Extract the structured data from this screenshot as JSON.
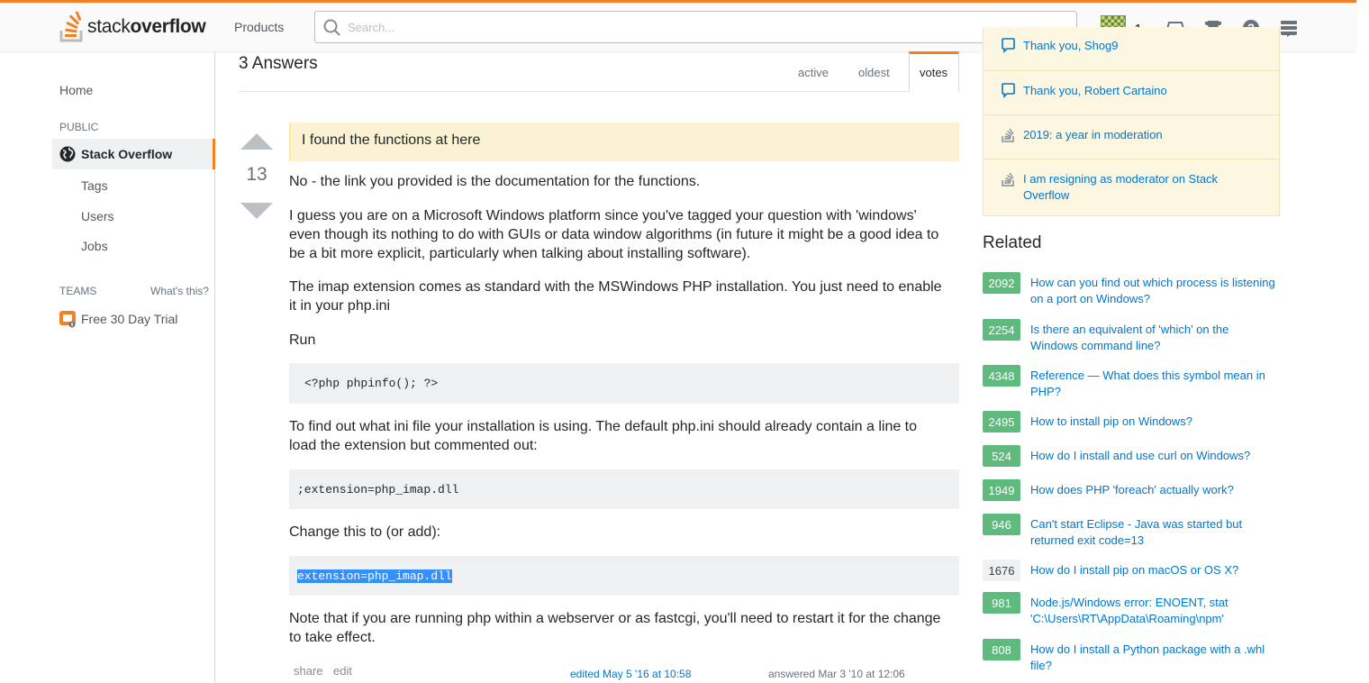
{
  "header": {
    "logo_light": "stack",
    "logo_bold": "overflow",
    "products": "Products",
    "search_placeholder": "Search...",
    "reputation": "1",
    "brand_color": "#f48024"
  },
  "leftnav": {
    "home": "Home",
    "public": "PUBLIC",
    "stack_overflow": "Stack Overflow",
    "tags": "Tags",
    "users": "Users",
    "jobs": "Jobs",
    "teams": "TEAMS",
    "whats_this": "What's this?",
    "trial": "Free 30 Day Trial"
  },
  "answers": {
    "title": "3 Answers",
    "tabs": [
      "active",
      "oldest",
      "votes"
    ]
  },
  "post": {
    "votes": "13",
    "quote": "I found the functions at here",
    "p1": "No - the link you provided is the documentation for the functions.",
    "p2": "I guess you are on a Microsoft Windows platform since you've tagged your question with 'windows' even though its nothing to do with GUIs or data window algorithms (in future it might be a good idea to be a bit more explicit, particularly when talking about installing software).",
    "p3": "The imap extension comes as standard with the MSWindows PHP installation. You just need to enable it in your php.ini",
    "p4": "Run",
    "code1": "<?php phpinfo(); ?>",
    "p5": "To find out what ini file your installation is using. The default php.ini should already contain a line to load the extension but commented out:",
    "code2": ";extension=php_imap.dll",
    "p6": "Change this to (or add):",
    "code3": "extension=php_imap.dll",
    "p7": "Note that if you are running php within a webserver or as fastcgi, you'll need to restart it for the change to take effect.",
    "share": "share",
    "edit": "edit",
    "edited": "edited May 5 '16 at 10:58",
    "answered": "answered Mar 3 '10 at 12:06"
  },
  "blog": {
    "items": [
      "Thank you, Shog9",
      "Thank you, Robert Cartaino",
      "2019: a year in moderation",
      "I am resigning as moderator on Stack Overflow"
    ]
  },
  "related": {
    "title": "Related",
    "items": [
      {
        "score": "2092",
        "title": "How can you find out which process is listening on a port on Windows?"
      },
      {
        "score": "2254",
        "title": "Is there an equivalent of 'which' on the Windows command line?"
      },
      {
        "score": "4348",
        "title": "Reference — What does this symbol mean in PHP?"
      },
      {
        "score": "2495",
        "title": "How to install pip on Windows?"
      },
      {
        "score": "524",
        "title": "How do I install and use curl on Windows?"
      },
      {
        "score": "1949",
        "title": "How does PHP 'foreach' actually work?"
      },
      {
        "score": "946",
        "title": "Can't start Eclipse - Java was started but returned exit code=13"
      },
      {
        "score": "1676",
        "title": "How do I install pip on macOS or OS X?"
      },
      {
        "score": "981",
        "title": "Node.js/Windows error: ENOENT, stat 'C:\\Users\\RT\\AppData\\Roaming\\npm'"
      },
      {
        "score": "808",
        "title": "How do I install a Python package with a .whl file?"
      }
    ]
  }
}
